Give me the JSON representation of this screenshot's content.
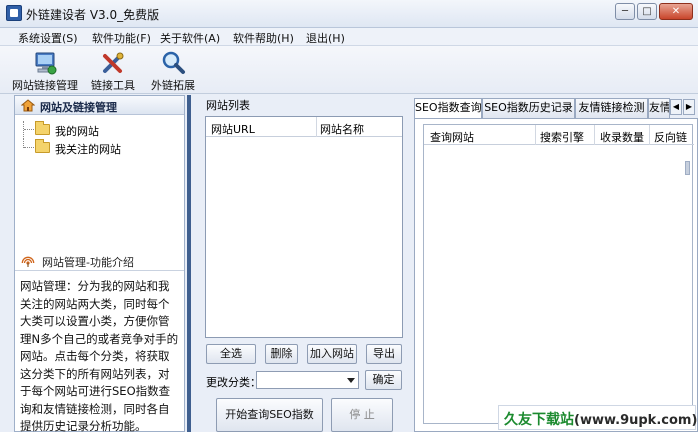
{
  "window": {
    "title": "外链建设者 V3.0_免费版",
    "min_icon": "minimize-icon",
    "max_icon": "maximize-icon",
    "close_icon": "close-icon"
  },
  "menu": [
    "系统设置(S)",
    "软件功能(F)",
    "关于软件(A)",
    "软件帮助(H)",
    "退出(H)"
  ],
  "toolbar": {
    "items": [
      {
        "label": "网站链接管理",
        "icon": "monitor-network-icon"
      },
      {
        "label": "链接工具",
        "icon": "tools-icon"
      },
      {
        "label": "外链拓展",
        "icon": "magnifier-icon"
      }
    ]
  },
  "left_panel": {
    "header": "网站及链接管理",
    "tree": [
      "我的网站",
      "我关注的网站"
    ],
    "intro_title": "网站管理-功能介绍",
    "intro_text": "网站管理：分为我的网站和我关注的网站两大类，同时每个大类可以设置小类，方便你管理N多个自己的或者竞争对手的网站。点击每个分类，将获取这分类下的所有网站列表，对于每个网站可进行SEO指数查询和友情链接检测，同时各自提供历史记录分析功能。"
  },
  "middle": {
    "label": "网站列表",
    "columns": [
      "网站URL",
      "网站名称"
    ],
    "buttons": {
      "select_all": "全选",
      "delete": "删除",
      "add_site": "加入网站",
      "export": "导出",
      "confirm": "确定",
      "start_query": "开始查询SEO指数",
      "stop": "停 止"
    },
    "change_category_label": "更改分类：",
    "category_value": ""
  },
  "right": {
    "tabs": [
      "SEO指数查询",
      "SEO指数历史记录",
      "友情链接检测",
      "友情"
    ],
    "columns": [
      "查询网站",
      "搜索引擎",
      "收录数量",
      "反向链"
    ]
  },
  "watermark": {
    "text": "久友下载站",
    "url": "(www.9upk.com)"
  },
  "colors": {
    "accent": "#3f5f8f",
    "watermark_green": "#1b8a2e"
  }
}
